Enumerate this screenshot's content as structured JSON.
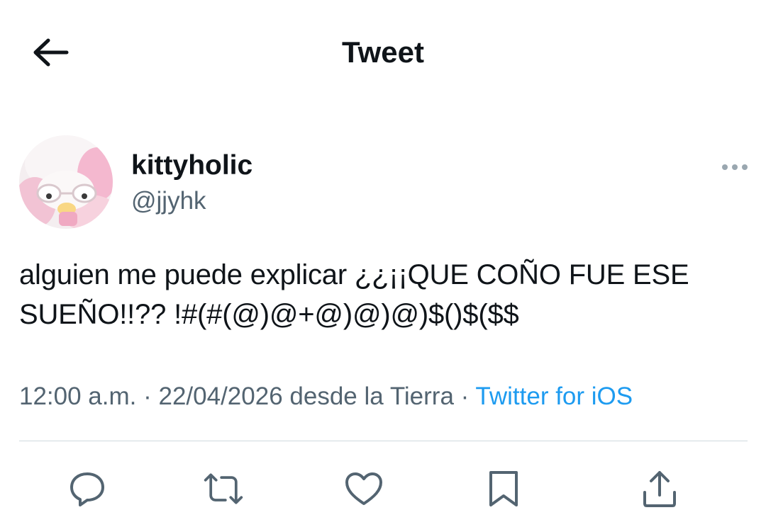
{
  "header": {
    "title": "Tweet",
    "back_icon": "arrow-left-icon"
  },
  "author": {
    "display_name": "kittyholic",
    "handle": "@jjyhk",
    "avatar_icon": "avatar-image"
  },
  "more_icon": "more-horizontal-icon",
  "tweet": {
    "text": "alguien me puede explicar ¿¿¡¡QUE COÑO FUE ESE SUEÑO!!?? !#(#(@)@+@)@)@)$()$($$"
  },
  "meta": {
    "time": "12:00 a.m.",
    "sep1": " · ",
    "date_location": "22/04/2026 desde la Tierra",
    "sep2": " · ",
    "source": "Twitter for iOS"
  },
  "colors": {
    "accent": "#1d9bf0",
    "text": "#0f1419",
    "secondary": "#536471",
    "divider": "#cfd9de"
  },
  "actions": [
    {
      "name": "reply",
      "icon": "reply-icon"
    },
    {
      "name": "retweet",
      "icon": "retweet-icon"
    },
    {
      "name": "like",
      "icon": "heart-icon"
    },
    {
      "name": "bookmark",
      "icon": "bookmark-icon"
    },
    {
      "name": "share",
      "icon": "share-icon"
    }
  ]
}
